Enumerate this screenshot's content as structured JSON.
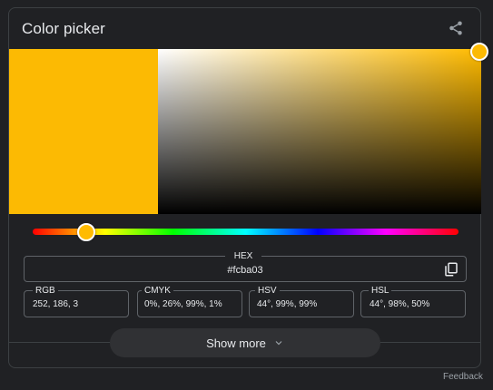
{
  "card": {
    "title": "Color picker",
    "share_icon": "share-icon"
  },
  "color": {
    "current_hex": "#fcba03",
    "hue_color": "#ffbb00"
  },
  "picker": {
    "saturation_percent": 99,
    "value_percent": 99,
    "hue_degrees": 44
  },
  "hex": {
    "label": "HEX",
    "value": "#fcba03",
    "copy_icon": "copy-icon"
  },
  "fields": [
    {
      "label": "RGB",
      "value": "252, 186, 3"
    },
    {
      "label": "CMYK",
      "value": "0%, 26%, 99%, 1%"
    },
    {
      "label": "HSV",
      "value": "44°, 99%, 99%"
    },
    {
      "label": "HSL",
      "value": "44°, 98%, 50%"
    }
  ],
  "show_more": {
    "label": "Show more",
    "icon": "chevron-down-icon"
  },
  "footer": {
    "feedback": "Feedback"
  }
}
